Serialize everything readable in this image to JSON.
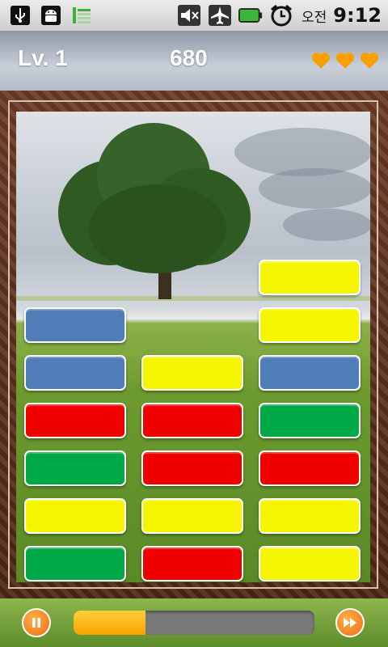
{
  "status_bar": {
    "icons": [
      "usb-icon",
      "android-debug-icon",
      "signal-bars-icon",
      "mute-icon",
      "airplane-mode-icon",
      "battery-icon",
      "alarm-clock-icon"
    ],
    "ampm": "오전",
    "time": "9:12"
  },
  "header": {
    "level": "Lv. 1",
    "score": "680",
    "lives": 3,
    "heart_color": "#f7a000"
  },
  "board": {
    "columns": 3,
    "rows_from_top": [
      [
        null,
        null,
        "yellow"
      ],
      [
        "blue",
        null,
        "yellow"
      ],
      [
        "blue",
        "yellow",
        "blue"
      ],
      [
        "red",
        "red",
        "green"
      ],
      [
        "green",
        "red",
        "red"
      ],
      [
        "yellow",
        "yellow",
        "yellow"
      ],
      [
        "green",
        "red",
        "yellow"
      ]
    ],
    "colors": {
      "yellow": "#f5f500",
      "blue": "#4f7db8",
      "red": "#f10000",
      "green": "#00a947"
    }
  },
  "controls": {
    "pause_icon": "pause-icon",
    "fast_forward_icon": "fast-forward-icon",
    "progress_fraction": 0.3
  }
}
